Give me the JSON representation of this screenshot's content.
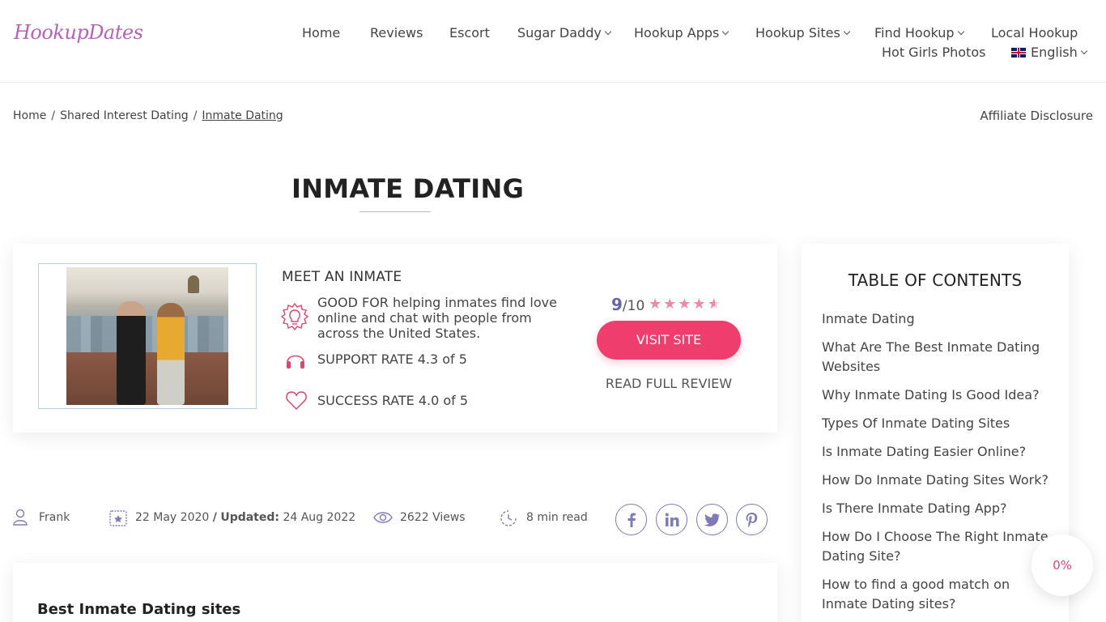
{
  "header": {
    "logo_text": "HookupDates",
    "nav": [
      {
        "label": "Home"
      },
      {
        "label": "Reviews"
      },
      {
        "label": "Escort"
      },
      {
        "label": "Sugar Daddy"
      },
      {
        "label": "Hookup Apps"
      },
      {
        "label": "Hookup Sites"
      },
      {
        "label": "Find Hookup"
      },
      {
        "label": "Local Hookup"
      },
      {
        "label": "Hot Girls Photos"
      },
      {
        "label": "English"
      }
    ]
  },
  "breadcrumb": {
    "items": [
      "Home",
      "Shared Interest Dating",
      "Inmate Dating"
    ],
    "separator": "/"
  },
  "affiliate_disclosure": "Affiliate Disclosure",
  "page_title": "INMATE DATING",
  "review_card": {
    "site_name": "MEET AN INMATE",
    "good_for": "GOOD FOR helping inmates find love online and chat with people from across the United States.",
    "support_rate": "SUPPORT RATE 4.3 of 5",
    "success_rate": "SUCCESS RATE 4.0 of 5",
    "score": "9",
    "score_max": "/10",
    "stars": 4.5,
    "visit_label": "VISIT SITE",
    "read_review_label": "READ FULL REVIEW",
    "accent_color": "#ef3e6e"
  },
  "meta": {
    "author": "Frank",
    "published": "22 May 2020",
    "updated_sep": "/",
    "updated_label": "Updated:",
    "updated": "24 Aug 2022",
    "views": "2622 Views",
    "read_time": "8 min read",
    "social": [
      "facebook-icon",
      "linkedin-icon",
      "twitter-icon",
      "pinterest-icon"
    ]
  },
  "content": {
    "heading": "Best Inmate Dating sites"
  },
  "toc": {
    "title": "TABLE OF CONTENTS",
    "items": [
      "Inmate Dating",
      "What Are The Best Inmate Dating Websites",
      "Why Inmate Dating Is Good Idea?",
      "Types Of Inmate Dating Sites",
      "Is Inmate Dating Easier Online?",
      "How Do Inmate Dating Sites Work?",
      "Is There Inmate Dating App?",
      "How Do I Choose The Right Inmate Dating Site?",
      "How to find a good match on Inmate Dating sites?"
    ]
  },
  "reading_progress": "0%"
}
